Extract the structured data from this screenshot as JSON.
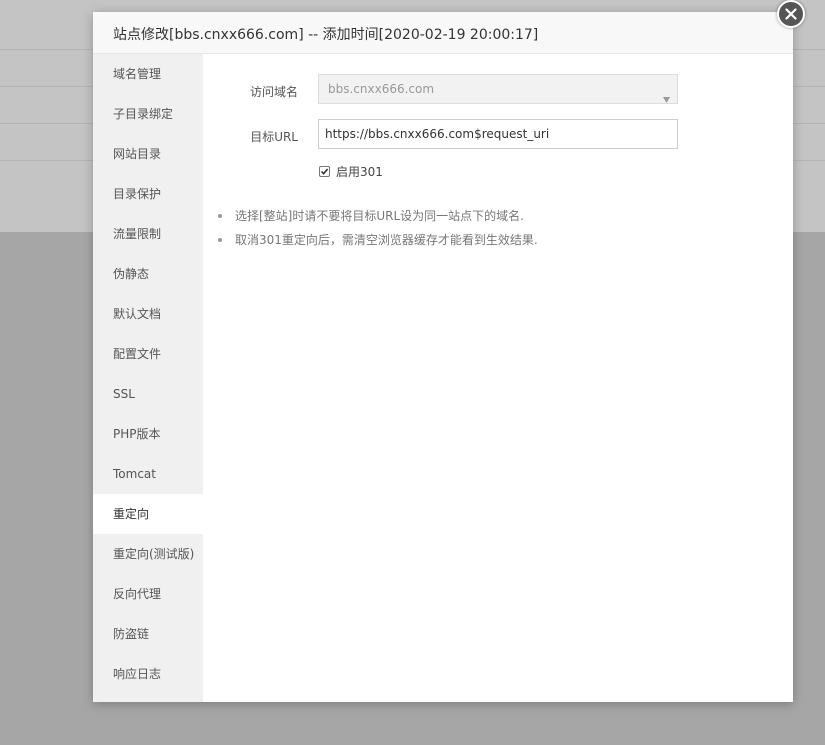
{
  "modal": {
    "title": "站点修改[bbs.cnxx666.com] -- 添加时间[2020-02-19 20:00:17]"
  },
  "sidebar": {
    "items": [
      {
        "label": "域名管理"
      },
      {
        "label": "子目录绑定"
      },
      {
        "label": "网站目录"
      },
      {
        "label": "目录保护"
      },
      {
        "label": "流量限制"
      },
      {
        "label": "伪静态"
      },
      {
        "label": "默认文档"
      },
      {
        "label": "配置文件"
      },
      {
        "label": "SSL"
      },
      {
        "label": "PHP版本"
      },
      {
        "label": "Tomcat"
      },
      {
        "label": "重定向"
      },
      {
        "label": "重定向(测试版)"
      },
      {
        "label": "反向代理"
      },
      {
        "label": "防盗链"
      },
      {
        "label": "响应日志"
      }
    ],
    "active": "重定向"
  },
  "form": {
    "domain_label": "访问域名",
    "domain_value": "bbs.cnxx666.com",
    "target_label": "目标URL",
    "target_value": "https://bbs.cnxx666.com$request_uri",
    "enable_301_label": "启用301",
    "enable_301_checked": true
  },
  "tips": [
    "选择[整站]时请不要将目标URL设为同一站点下的域名.",
    "取消301重定向后，需清空浏览器缓存才能看到生效结果."
  ],
  "icons": {
    "close": "close-icon",
    "dropdown": "chevron-down-icon",
    "check": "check-icon"
  },
  "colors": {
    "close_button": "#555555",
    "sidebar_bg": "#f0f0f0",
    "overlay": "#a6a6a6"
  }
}
